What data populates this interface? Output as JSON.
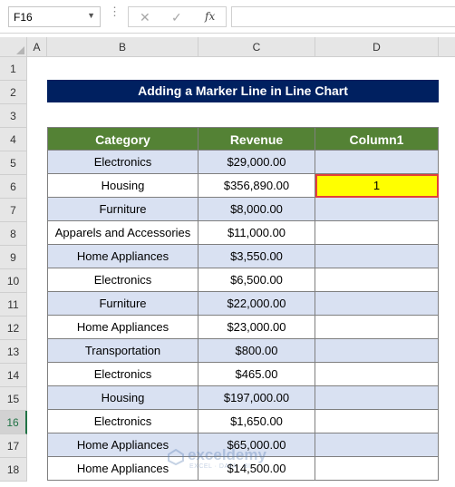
{
  "formula_bar": {
    "name_box": "F16",
    "cancel_icon": "✕",
    "enter_icon": "✓",
    "fx_label": "fx",
    "formula": ""
  },
  "columns": [
    "A",
    "B",
    "C",
    "D"
  ],
  "rows": [
    "1",
    "2",
    "3",
    "4",
    "5",
    "6",
    "7",
    "8",
    "9",
    "10",
    "11",
    "12",
    "13",
    "14",
    "15",
    "16",
    "17",
    "18"
  ],
  "active_row": "16",
  "sheet": {
    "title": "Adding a Marker Line in Line Chart",
    "headers": {
      "category": "Category",
      "revenue": "Revenue",
      "column1": "Column1"
    },
    "records": [
      {
        "category": "Electronics",
        "revenue": "$29,000.00",
        "column1": ""
      },
      {
        "category": "Housing",
        "revenue": "$356,890.00",
        "column1": "1"
      },
      {
        "category": "Furniture",
        "revenue": "$8,000.00",
        "column1": ""
      },
      {
        "category": "Apparels and Accessories",
        "revenue": "$11,000.00",
        "column1": ""
      },
      {
        "category": "Home Appliances",
        "revenue": "$3,550.00",
        "column1": ""
      },
      {
        "category": "Electronics",
        "revenue": "$6,500.00",
        "column1": ""
      },
      {
        "category": "Furniture",
        "revenue": "$22,000.00",
        "column1": ""
      },
      {
        "category": "Home Appliances",
        "revenue": "$23,000.00",
        "column1": ""
      },
      {
        "category": "Transportation",
        "revenue": "$800.00",
        "column1": ""
      },
      {
        "category": "Electronics",
        "revenue": "$465.00",
        "column1": ""
      },
      {
        "category": "Housing",
        "revenue": "$197,000.00",
        "column1": ""
      },
      {
        "category": "Electronics",
        "revenue": "$1,650.00",
        "column1": ""
      },
      {
        "category": "Home Appliances",
        "revenue": "$65,000.00",
        "column1": ""
      },
      {
        "category": "Home Appliances",
        "revenue": "$14,500.00",
        "column1": ""
      }
    ]
  },
  "watermark": {
    "name": "exceldemy",
    "tagline": "EXCEL · DATA · BI"
  },
  "colors": {
    "title_bg": "#002060",
    "header_bg": "#548235",
    "band": "#d9e1f2",
    "highlight": "#ffff00",
    "highlight_border": "#e2403a"
  }
}
